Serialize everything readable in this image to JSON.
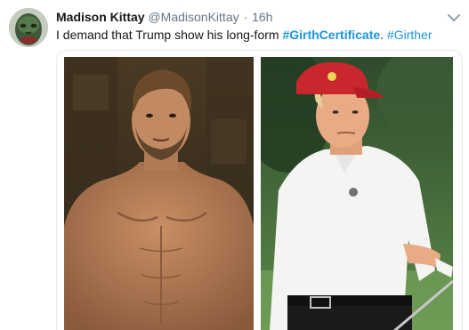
{
  "tweet": {
    "display_name": "Madison Kittay",
    "handle": "@MadisonKittay",
    "separator": "·",
    "timestamp": "16h",
    "text_prefix": "I demand that Trump show his long-form ",
    "hashtag_1": "#GirthCertificate",
    "text_middle": ". ",
    "hashtag_2": "#Girther",
    "avatar_icon": "green-mask-avatar",
    "menu_icon": "chevron-down-icon"
  },
  "media": {
    "photos": [
      {
        "name": "shirtless-man-photo"
      },
      {
        "name": "man-in-golf-attire-photo"
      }
    ]
  },
  "colors": {
    "text": "#14171a",
    "secondary": "#657786",
    "link": "#1b95e0",
    "border": "#e6ecf0"
  }
}
